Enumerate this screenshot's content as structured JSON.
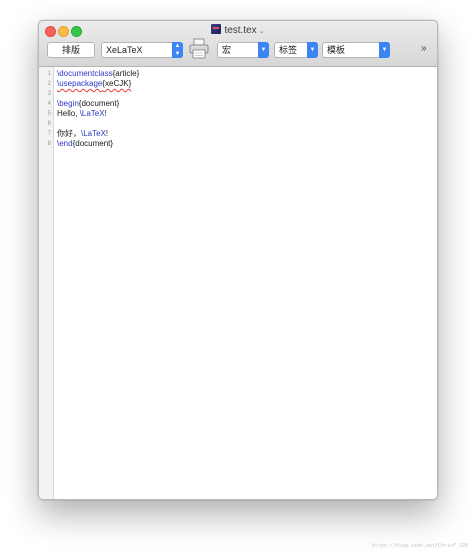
{
  "window": {
    "title": "test.tex",
    "title_chevron": "⌄"
  },
  "toolbar": {
    "typeset_label": "排版",
    "engine_value": "XeLaTeX",
    "macro_label": "宏",
    "tags_label": "标签",
    "templates_label": "模板",
    "more_label": "»"
  },
  "gutter": {
    "line_numbers": [
      "1",
      "2",
      "3",
      "4",
      "5",
      "6",
      "7",
      "8"
    ]
  },
  "editor": {
    "lines": [
      {
        "cmd": "\\documentclass",
        "rest": "{article}"
      },
      {
        "cmd": "\\usepackage",
        "rest": "{xeCJK}"
      },
      {
        "cmd": "",
        "rest": ""
      },
      {
        "cmd": "\\begin",
        "rest": "{document}"
      },
      {
        "pre": "Hello, ",
        "cmd": "\\LaTeX",
        "rest": "!"
      },
      {
        "cmd": "",
        "rest": ""
      },
      {
        "pre": "你好，",
        "cmd": "\\LaTeX",
        "rest": "!"
      },
      {
        "cmd": "\\end",
        "rest": "{document}"
      }
    ]
  },
  "colors": {
    "command": "#2c39c7",
    "accent": "#3b85f3",
    "close": "#fc605b",
    "minimize": "#fdbc40",
    "maximize": "#34c84a"
  },
  "watermark": "https://blog.csdn.net/ChrisF_328"
}
